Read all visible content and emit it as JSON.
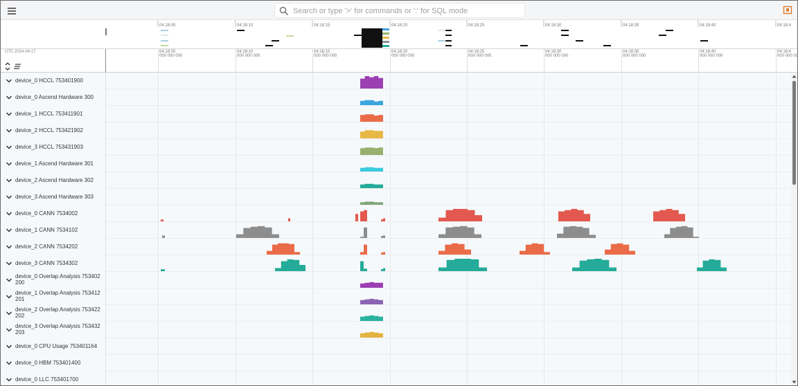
{
  "header": {
    "menu_icon": "hamburger-menu-icon",
    "search_placeholder": "Search or type '>' for commands or ':' for SQL mode",
    "search_icon": "search-icon",
    "bookmark_icon": "bookmark-icon"
  },
  "overview": {
    "tick_labels": [
      "04:18:05",
      "04:18:10",
      "04:18:15",
      "04:18:20",
      "04:18:25",
      "04:18:30",
      "04:18:35",
      "04:18:40",
      "04:18:4"
    ]
  },
  "timeaxis": {
    "date_label": "UTC 2024-04-17",
    "tick_labels": [
      {
        "time": "04:18:05",
        "sub": "000 000 000"
      },
      {
        "time": "04:18:10",
        "sub": "000 000 000"
      },
      {
        "time": "04:18:15",
        "sub": "000 000 000"
      },
      {
        "time": "04:18:20",
        "sub": "000 000 000"
      },
      {
        "time": "04:18:25",
        "sub": "000 000 000"
      },
      {
        "time": "04:18:30",
        "sub": "000 000 000"
      },
      {
        "time": "04:18:35",
        "sub": "000 000 000"
      },
      {
        "time": "04:18:40",
        "sub": "000 000 000"
      },
      {
        "time": "04:18:4",
        "sub": "000 000 000"
      }
    ],
    "collapse_icon": "expand-collapse-icon",
    "sort_icon": "sort-lines-icon"
  },
  "colors": {
    "purple": "#9c3fb3",
    "blue": "#3ba6dd",
    "orange": "#ea6b48",
    "yellow": "#e9b746",
    "green": "#98b06e",
    "cyan": "#3ccadf",
    "teal": "#25ab99",
    "sage": "#80a478",
    "red": "#e3594f",
    "gray": "#8d8d8d",
    "violet": "#8c64b4",
    "teal2": "#2bb29f",
    "gold": "#e4b23f"
  },
  "tracks": [
    {
      "title": "device_0 HCCL 753401900",
      "color": "purple"
    },
    {
      "title": "device_0 Ascend Hardware 300",
      "color": "blue"
    },
    {
      "title": "device_1 HCCL 753411901",
      "color": "orange"
    },
    {
      "title": "device_2 HCCL 753421902",
      "color": "yellow"
    },
    {
      "title": "device_3 HCCL 753431903",
      "color": "green"
    },
    {
      "title": "device_1 Ascend Hardware 301",
      "color": "cyan"
    },
    {
      "title": "device_2 Ascend Hardware 302",
      "color": "teal"
    },
    {
      "title": "device_3 Ascend Hardware 303",
      "color": "sage"
    },
    {
      "title": "device_0 CANN 7534002",
      "color": "red"
    },
    {
      "title": "device_1 CANN 7534102",
      "color": "gray"
    },
    {
      "title": "device_2 CANN 7534202",
      "color": "orange"
    },
    {
      "title": "device_3 CANN 7534302",
      "color": "teal"
    },
    {
      "title": "device_0 Overlap Analysis 753402200",
      "color": "purple"
    },
    {
      "title": "device_1 Overlap Analysis 753412201",
      "color": "violet"
    },
    {
      "title": "device_2 Overlap Analysis 753422202",
      "color": "teal2"
    },
    {
      "title": "device_3 Overlap Analysis 753432203",
      "color": "gold"
    },
    {
      "title": "device_0 CPU Usage 753401164",
      "color": "gray"
    },
    {
      "title": "device_0 HBM 753401400",
      "color": "gray"
    },
    {
      "title": "device_0 LLC 753401700",
      "color": "gray"
    }
  ]
}
